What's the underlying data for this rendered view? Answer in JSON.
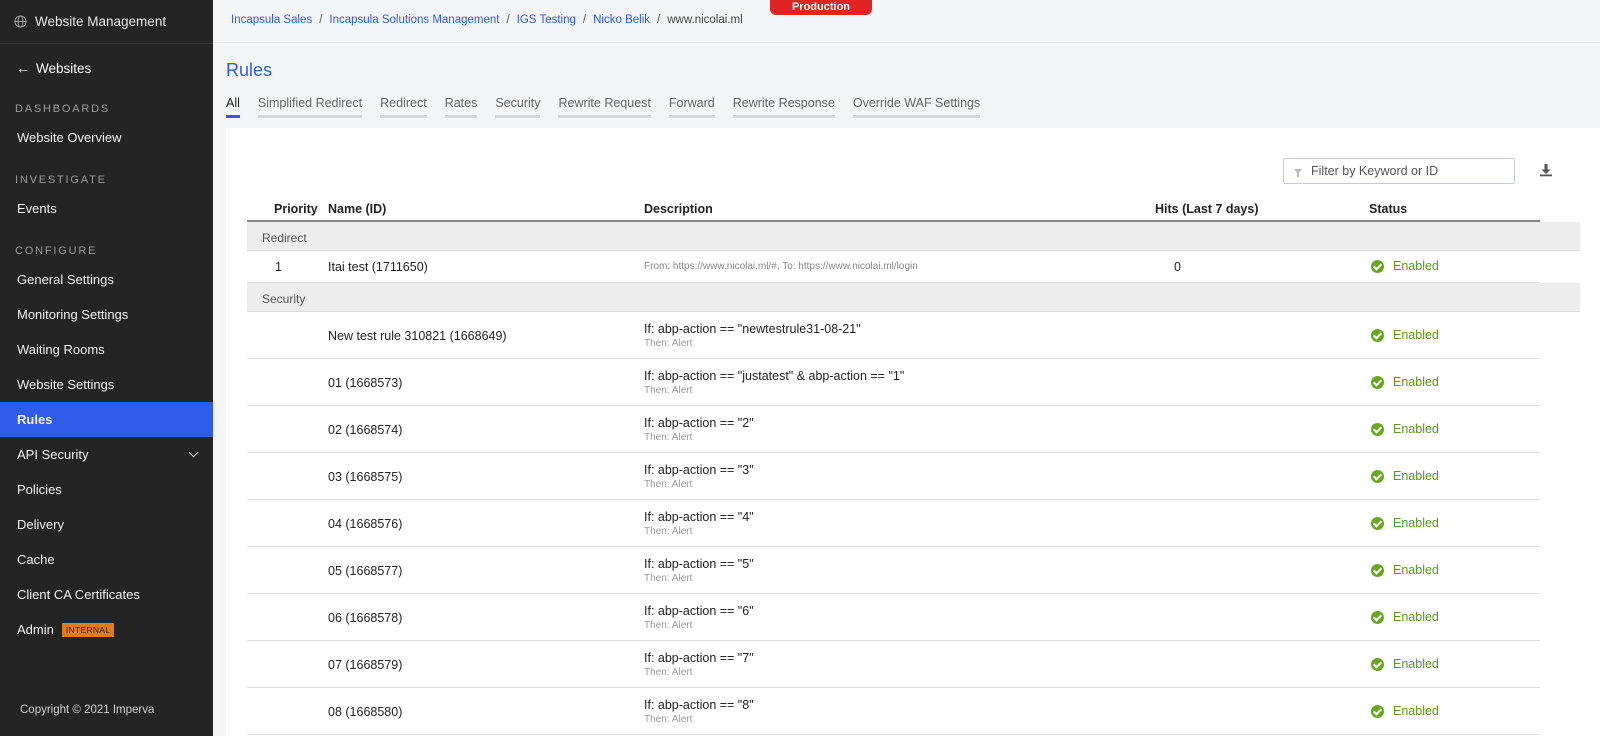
{
  "sidebar": {
    "header": "Website Management",
    "header_icon": "globe-icon",
    "back_label": "Websites",
    "sections": {
      "dashboards": "DASHBOARDS",
      "investigate": "INVESTIGATE",
      "configure": "CONFIGURE"
    },
    "items": {
      "website_overview": "Website Overview",
      "events": "Events",
      "general_settings": "General Settings",
      "monitoring_settings": "Monitoring Settings",
      "waiting_rooms": "Waiting Rooms",
      "website_settings": "Website Settings",
      "rules": "Rules",
      "api_security": "API Security",
      "policies": "Policies",
      "delivery": "Delivery",
      "cache": "Cache",
      "client_ca": "Client CA Certificates",
      "admin": "Admin"
    },
    "admin_badge": "INTERNAL",
    "footer": "Copyright © 2021 Imperva"
  },
  "breadcrumb": {
    "items": [
      "Incapsula Sales",
      "Incapsula Solutions Management",
      "IGS Testing",
      "Nicko Belik"
    ],
    "current": "www.nicolai.ml",
    "separator": "/"
  },
  "environment_badge": "Production",
  "page": {
    "title": "Rules",
    "tabs": [
      "All",
      "Simplified Redirect",
      "Redirect",
      "Rates",
      "Security",
      "Rewrite Request",
      "Forward",
      "Rewrite Response",
      "Override WAF Settings"
    ],
    "active_tab": "All"
  },
  "filter": {
    "placeholder": "Filter by Keyword or ID"
  },
  "table": {
    "headers": {
      "priority": "Priority",
      "name": "Name (ID)",
      "description": "Description",
      "hits": "Hits (Last 7 days)",
      "status": "Status"
    },
    "groups": {
      "redirect": {
        "label": "Redirect",
        "rows": [
          {
            "priority": "1",
            "name": "Itai test (1711650)",
            "desc": "From: https://www.nicolai.ml/#, To: https://www.nicolai.ml/login",
            "hits": "0",
            "status": "Enabled"
          }
        ]
      },
      "security": {
        "label": "Security",
        "rows": [
          {
            "name": "New test rule 310821 (1668649)",
            "cond": "If: abp-action == \"newtestrule31-08-21\"",
            "then": "Then: Alert",
            "status": "Enabled"
          },
          {
            "name": "01 (1668573)",
            "cond": "If: abp-action == \"justatest\" & abp-action == \"1\"",
            "then": "Then: Alert",
            "status": "Enabled"
          },
          {
            "name": "02 (1668574)",
            "cond": "If: abp-action == \"2\"",
            "then": "Then: Alert",
            "status": "Enabled"
          },
          {
            "name": "03 (1668575)",
            "cond": "If: abp-action == \"3\"",
            "then": "Then: Alert",
            "status": "Enabled"
          },
          {
            "name": "04 (1668576)",
            "cond": "If: abp-action == \"4\"",
            "then": "Then: Alert",
            "status": "Enabled"
          },
          {
            "name": "05 (1668577)",
            "cond": "If: abp-action == \"5\"",
            "then": "Then: Alert",
            "status": "Enabled"
          },
          {
            "name": "06 (1668578)",
            "cond": "If: abp-action == \"6\"",
            "then": "Then: Alert",
            "status": "Enabled"
          },
          {
            "name": "07 (1668579)",
            "cond": "If: abp-action == \"7\"",
            "then": "Then: Alert",
            "status": "Enabled"
          },
          {
            "name": "08 (1668580)",
            "cond": "If: abp-action == \"8\"",
            "then": "Then: Alert",
            "status": "Enabled"
          }
        ]
      }
    }
  },
  "colors": {
    "accent": "#2f5bea",
    "sidebar_bg": "#242424",
    "enabled": "#5a9a1e",
    "production": "#e02424"
  }
}
